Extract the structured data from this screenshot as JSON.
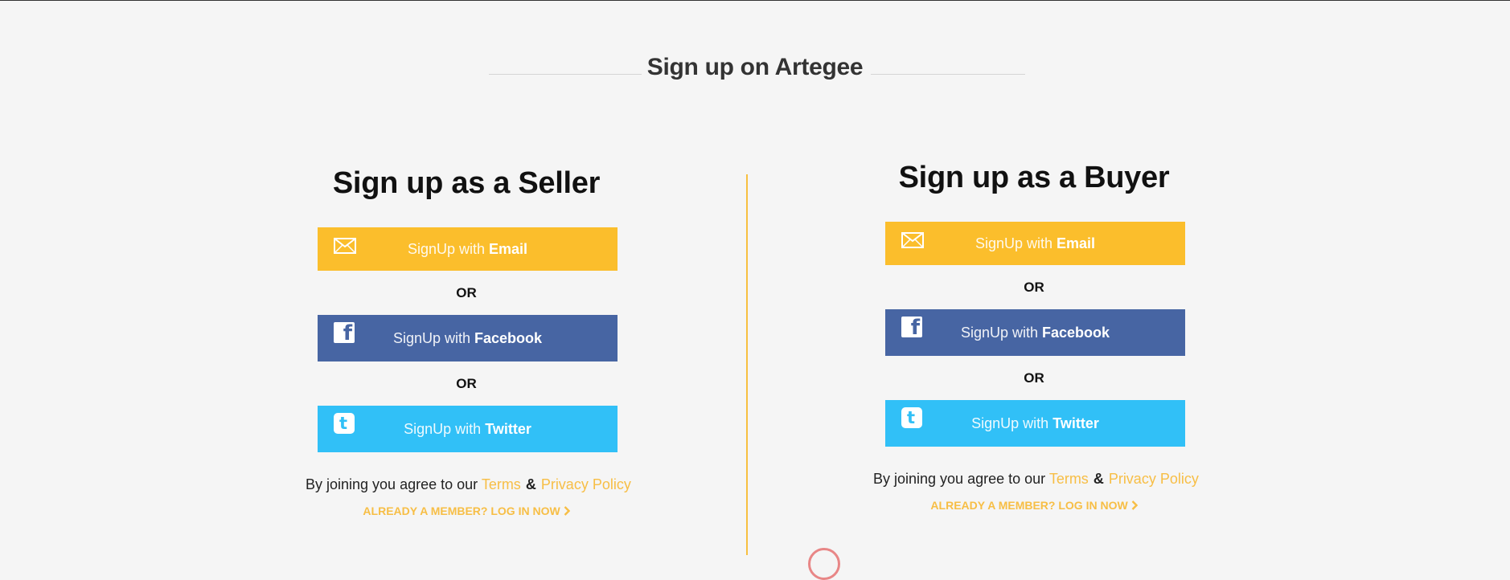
{
  "header": {
    "title": "Sign up on Artegee"
  },
  "seller": {
    "title": "Sign up as a Seller",
    "email_pre": "SignUp with ",
    "email_strong": "Email",
    "or_1": "OR",
    "facebook_pre": "SignUp with ",
    "facebook_strong": "Facebook",
    "or_2": "OR",
    "twitter_pre": "SignUp with ",
    "twitter_strong": "Twitter",
    "agree_text": "By joining you agree to our ",
    "terms": "Terms",
    "amp": "&",
    "privacy": "Privacy Policy",
    "login": "ALREADY A MEMBER? LOG IN NOW"
  },
  "buyer": {
    "title": "Sign up as a Buyer",
    "email_pre": "SignUp with ",
    "email_strong": "Email",
    "or_1": "OR",
    "facebook_pre": "SignUp with ",
    "facebook_strong": "Facebook",
    "or_2": "OR",
    "twitter_pre": "SignUp with ",
    "twitter_strong": "Twitter",
    "agree_text": "By joining you agree to our ",
    "terms": "Terms",
    "amp": "&",
    "privacy": "Privacy Policy",
    "login": "ALREADY A MEMBER? LOG IN NOW"
  },
  "icons": {
    "email": "envelope-icon",
    "facebook": "facebook-icon",
    "twitter": "twitter-icon",
    "chevron": "chevron-right-icon"
  },
  "colors": {
    "email": "#fbbe2c",
    "facebook": "#4765a3",
    "twitter": "#31c0f7",
    "accent": "#f7be45",
    "background": "#f5f5f5"
  }
}
